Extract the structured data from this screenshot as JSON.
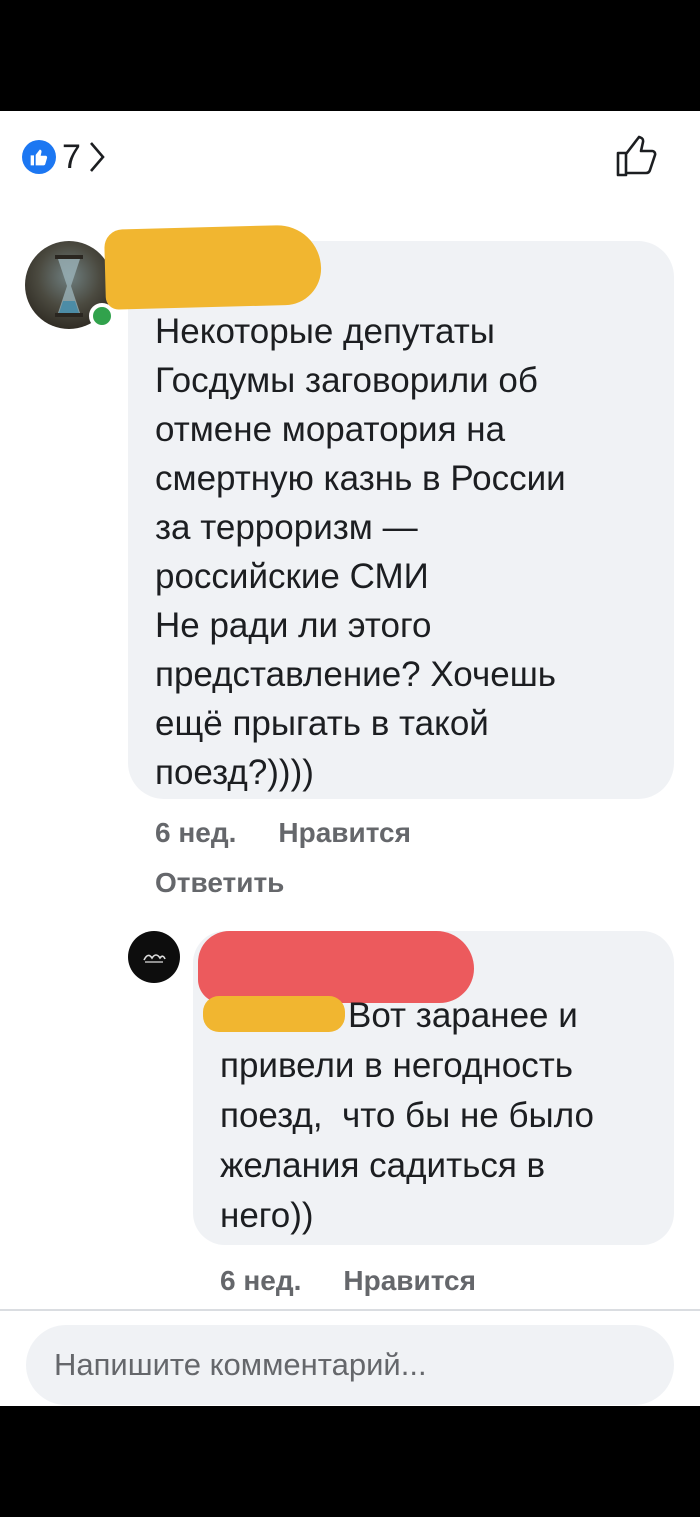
{
  "reactions": {
    "icon": "thumbs-up-icon",
    "count": "7",
    "accent": "#1c77f2"
  },
  "comments": [
    {
      "author_redacted": true,
      "avatar_online": true,
      "text": "Некоторые депутаты\nГосдумы заговорили об\nотмене моратория на\nсмертную казнь в России\nза терроризм —\nроссийские СМИ\nНе ради ли этого\nпредставление? Хочешь\nещё прыгать в такой\nпоезд?))))",
      "time": "6 нед.",
      "like_label": "Нравится",
      "reply_label": "Ответить"
    },
    {
      "author_redacted": true,
      "mention_redacted": true,
      "text_first_line": "Вот заранее и",
      "text_rest": "привели в негодность\nпоезд,  что бы не было\nжелания садиться в\nнего))",
      "time": "6 нед.",
      "like_label": "Нравится"
    }
  ],
  "composer": {
    "placeholder": "Напишите комментарий..."
  },
  "colors": {
    "bubble": "#f0f2f5",
    "meta_text": "#65676b",
    "online": "#31a24c",
    "redact_yellow": "#f1b630",
    "redact_red": "#ec5a5d"
  }
}
